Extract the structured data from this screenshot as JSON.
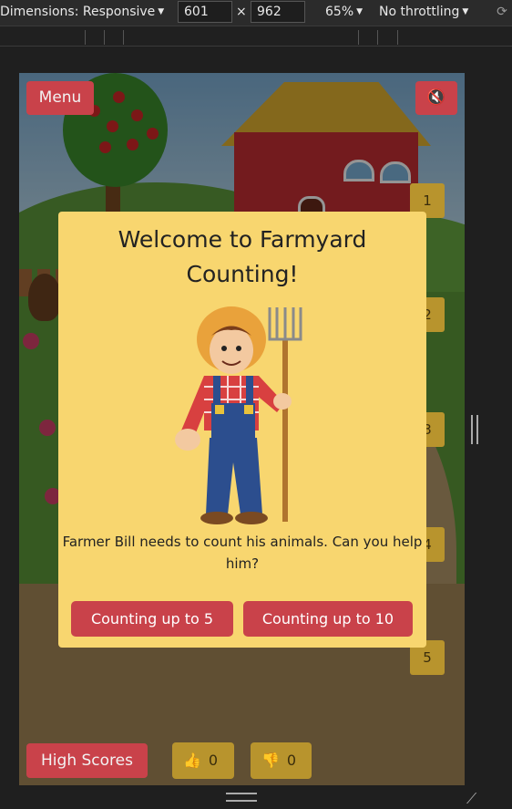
{
  "devtools": {
    "dimensions_label": "Dimensions: Responsive",
    "width_value": "601",
    "times": "×",
    "height_value": "962",
    "zoom": "65%",
    "throttling": "No throttling",
    "rotate_icon": "rotate-icon"
  },
  "game": {
    "menu_label": "Menu",
    "mute_icon": "mute-speaker-icon",
    "high_scores_label": "High Scores",
    "number_badges": [
      "1",
      "2",
      "3",
      "4",
      "5"
    ],
    "thumbs_up_count": "0",
    "thumbs_down_count": "0"
  },
  "modal": {
    "title_line1": "Welcome to Farmyard",
    "title_line2": "Counting!",
    "text": "Farmer Bill needs to count his animals. Can you help him?",
    "button_5": "Counting up to 5",
    "button_10": "Counting up to 10"
  },
  "colors": {
    "modal_bg": "#f8d66f",
    "button_red": "#c9424a",
    "badge_gold": "#b8942d"
  }
}
